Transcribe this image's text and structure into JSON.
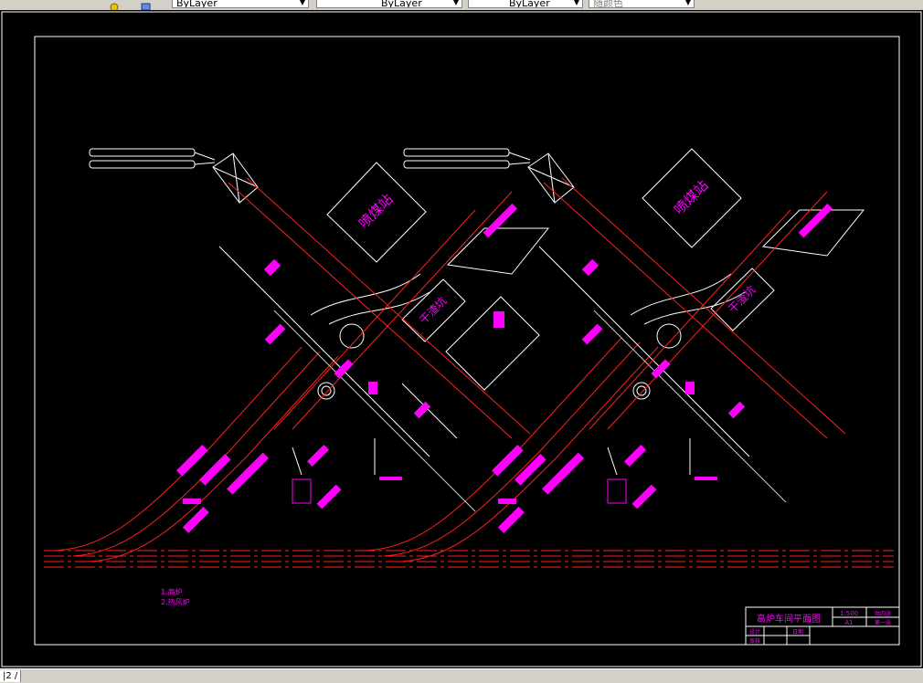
{
  "toolbar": {
    "layer_color": "ByLayer",
    "linetype": "ByLayer",
    "lineweight": "ByLayer",
    "plotstyle": "随颜色"
  },
  "drawing": {
    "left_block": {
      "coal_station": "喷煤站",
      "slag_pit": "干渣坑"
    },
    "right_block": {
      "coal_station": "喷煤站",
      "slag_pit": "干渣坑"
    },
    "legend": [
      "1.高炉",
      "2.热风炉"
    ],
    "title_block": {
      "title": "高炉车间平面图",
      "scale": "1:500",
      "sheet_size": "A1",
      "sheet_total": "共四张",
      "sheet_no": "第一张",
      "design_label": "设计",
      "review_label": "审核",
      "date_label": "日期"
    }
  },
  "colors": {
    "frame": "#ffffff",
    "rail": "#ff0000",
    "equipment": "#ff00ff",
    "background": "#000000"
  },
  "command_tab": "|2 /"
}
